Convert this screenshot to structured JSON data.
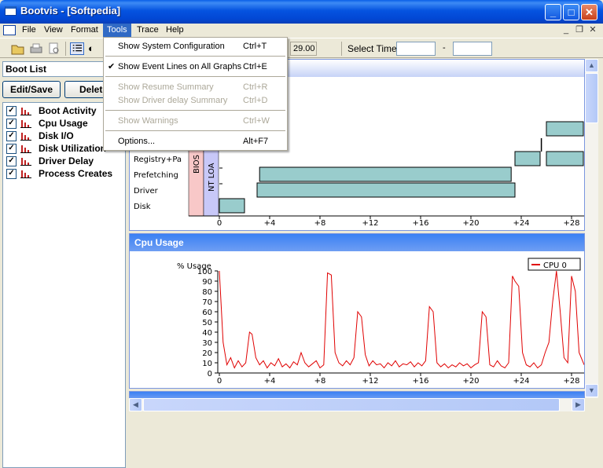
{
  "window": {
    "title": "Bootvis - [Softpedia]"
  },
  "menubar": {
    "items": [
      "File",
      "View",
      "Format",
      "Tools",
      "Trace",
      "Help"
    ]
  },
  "toolbar": {
    "field_value": "29.00",
    "select_time_label": "Select Time",
    "range_separator": "-"
  },
  "tools_menu": {
    "items": [
      {
        "label": "Show System Configuration",
        "shortcut": "Ctrl+T",
        "enabled": true,
        "checked": false
      },
      {
        "label": "Show Event Lines on All Graphs",
        "shortcut": "Ctrl+E",
        "enabled": true,
        "checked": true
      },
      {
        "label": "Show Resume Summary",
        "shortcut": "Ctrl+R",
        "enabled": false,
        "checked": false
      },
      {
        "label": "Show Driver delay Summary",
        "shortcut": "Ctrl+D",
        "enabled": false,
        "checked": false
      },
      {
        "label": "Show Warnings",
        "shortcut": "Ctrl+W",
        "enabled": false,
        "checked": false
      },
      {
        "label": "Options...",
        "shortcut": "Alt+F7",
        "enabled": true,
        "checked": false
      }
    ]
  },
  "left_panel": {
    "combo_value": "Boot List",
    "edit_save_label": "Edit/Save",
    "delete_label": "Delete",
    "graphs": [
      {
        "label": "Boot Activity",
        "checked": true
      },
      {
        "label": "Cpu Usage",
        "checked": true
      },
      {
        "label": "Disk I/O",
        "checked": true
      },
      {
        "label": "Disk Utilization",
        "checked": true
      },
      {
        "label": "Driver Delay",
        "checked": true
      },
      {
        "label": "Process Creates",
        "checked": true
      }
    ]
  },
  "boot_activity": {
    "row_labels": [
      "Registry+Pa",
      "Prefetching",
      "Driver",
      "Disk"
    ],
    "phase_labels": [
      "BIOS",
      "NT LOA"
    ],
    "x_ticks": [
      "0",
      "+4",
      "+8",
      "+12",
      "+16",
      "+20",
      "+24",
      "+28"
    ]
  },
  "cpu_usage": {
    "title": "Cpu Usage",
    "y_label": "% Usage",
    "legend": "CPU 0",
    "y_ticks": [
      "100",
      "90",
      "80",
      "70",
      "60",
      "50",
      "40",
      "30",
      "20",
      "10",
      "0"
    ],
    "x_ticks": [
      "0",
      "+4",
      "+8",
      "+12",
      "+16",
      "+20",
      "+24",
      "+28"
    ]
  },
  "colors": {
    "cpu_line": "#E00000",
    "bar_fill": "#99CCCC",
    "bios": "#F8C8C8",
    "ntload": "#C8C8F8"
  },
  "chart_data": [
    {
      "type": "bar",
      "title": "",
      "categories": [
        "Registry+Pa",
        "Prefetching",
        "Driver",
        "Disk"
      ],
      "x_range": [
        -1.5,
        29
      ],
      "segments": [
        {
          "row": "Disk",
          "start": 0,
          "end": 2
        },
        {
          "row": "Driver",
          "start": 3,
          "end": 23.5
        },
        {
          "row": "Prefetching",
          "start": 3.2,
          "end": 23.2
        },
        {
          "row": "Registry+Pa",
          "start": 23.5,
          "end": 25.5
        },
        {
          "row": "Registry+Pa",
          "start": 26,
          "end": 29
        }
      ]
    },
    {
      "type": "line",
      "title": "",
      "ylabel": "% Usage",
      "ylim": [
        0,
        100
      ],
      "xlim": [
        -1.5,
        29
      ],
      "series": [
        {
          "name": "CPU 0",
          "values": [
            [
              0,
              100
            ],
            [
              0.3,
              30
            ],
            [
              0.6,
              8
            ],
            [
              0.9,
              15
            ],
            [
              1.2,
              5
            ],
            [
              1.5,
              12
            ],
            [
              1.8,
              6
            ],
            [
              2.1,
              10
            ],
            [
              2.4,
              40
            ],
            [
              2.6,
              38
            ],
            [
              2.9,
              15
            ],
            [
              3.2,
              8
            ],
            [
              3.5,
              12
            ],
            [
              3.8,
              5
            ],
            [
              4.1,
              10
            ],
            [
              4.4,
              7
            ],
            [
              4.7,
              14
            ],
            [
              5,
              6
            ],
            [
              5.3,
              9
            ],
            [
              5.6,
              5
            ],
            [
              5.9,
              11
            ],
            [
              6.2,
              8
            ],
            [
              6.5,
              20
            ],
            [
              6.8,
              10
            ],
            [
              7.1,
              6
            ],
            [
              7.4,
              9
            ],
            [
              7.7,
              12
            ],
            [
              8,
              5
            ],
            [
              8.3,
              8
            ],
            [
              8.6,
              98
            ],
            [
              8.9,
              96
            ],
            [
              9.2,
              20
            ],
            [
              9.5,
              10
            ],
            [
              9.8,
              7
            ],
            [
              10.1,
              12
            ],
            [
              10.4,
              8
            ],
            [
              10.7,
              15
            ],
            [
              11,
              60
            ],
            [
              11.3,
              55
            ],
            [
              11.6,
              18
            ],
            [
              11.9,
              7
            ],
            [
              12.2,
              12
            ],
            [
              12.5,
              8
            ],
            [
              12.8,
              9
            ],
            [
              13.1,
              5
            ],
            [
              13.4,
              10
            ],
            [
              13.7,
              7
            ],
            [
              14,
              12
            ],
            [
              14.3,
              6
            ],
            [
              14.6,
              9
            ],
            [
              14.9,
              8
            ],
            [
              15.2,
              11
            ],
            [
              15.5,
              6
            ],
            [
              15.8,
              10
            ],
            [
              16.1,
              7
            ],
            [
              16.4,
              12
            ],
            [
              16.7,
              65
            ],
            [
              17,
              60
            ],
            [
              17.3,
              10
            ],
            [
              17.6,
              6
            ],
            [
              17.9,
              9
            ],
            [
              18.2,
              5
            ],
            [
              18.5,
              8
            ],
            [
              18.8,
              6
            ],
            [
              19.1,
              10
            ],
            [
              19.4,
              7
            ],
            [
              19.7,
              9
            ],
            [
              20,
              5
            ],
            [
              20.3,
              8
            ],
            [
              20.6,
              10
            ],
            [
              20.9,
              60
            ],
            [
              21.2,
              55
            ],
            [
              21.5,
              8
            ],
            [
              21.8,
              6
            ],
            [
              22.1,
              12
            ],
            [
              22.4,
              7
            ],
            [
              22.7,
              5
            ],
            [
              23,
              10
            ],
            [
              23.3,
              95
            ],
            [
              23.5,
              90
            ],
            [
              23.8,
              85
            ],
            [
              24.1,
              20
            ],
            [
              24.4,
              8
            ],
            [
              24.7,
              6
            ],
            [
              25,
              10
            ],
            [
              25.3,
              5
            ],
            [
              25.6,
              8
            ],
            [
              25.9,
              20
            ],
            [
              26.2,
              30
            ],
            [
              26.5,
              70
            ],
            [
              26.8,
              100
            ],
            [
              27.1,
              60
            ],
            [
              27.4,
              15
            ],
            [
              27.7,
              10
            ],
            [
              28,
              95
            ],
            [
              28.3,
              80
            ],
            [
              28.6,
              20
            ],
            [
              29,
              8
            ]
          ]
        }
      ]
    }
  ]
}
